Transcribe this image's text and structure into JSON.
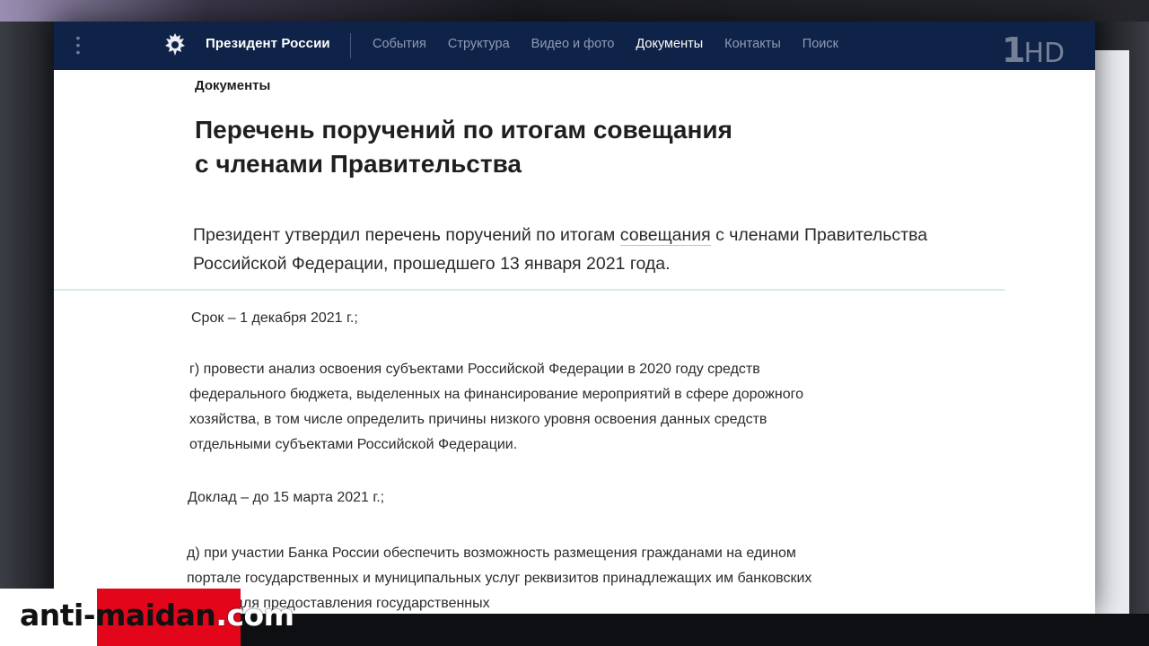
{
  "header": {
    "site_title": "Президент России",
    "nav": [
      "События",
      "Структура",
      "Видео и фото",
      "Документы",
      "Контакты",
      "Поиск"
    ],
    "active_nav_index": 3
  },
  "channel_logo": {
    "number": "1",
    "hd": "HD"
  },
  "content": {
    "breadcrumb": "Документы",
    "title_line1": "Перечень поручений по итогам совещания",
    "title_line2": "с членами Правительства",
    "lead_part1": "Президент утвердил перечень поручений по итогам ",
    "lead_link": "совещания",
    "lead_part2": " с членами Правительства Российской Федерации, прошедшего 13 января 2021 года.",
    "deadline1": "Срок – 1 декабря 2021 г.;",
    "item_g": "г) провести анализ освоения субъектами Российской Федерации в 2020 году средств федерального бюджета, выделенных на финансирование мероприятий в сфере дорожного хозяйства, в том числе определить причины низкого уровня освоения данных средств отдельными субъектами Российской Федерации.",
    "deadline2": "Доклад – до 15 марта 2021 г.;",
    "item_d": "д) при участии Банка России обеспечить возможность размещения гражданами на едином портале государственных и муниципальных услуг реквизитов принадлежащих им банковских счетов для предоставления государственных"
  },
  "watermark": {
    "part1": "anti-",
    "part2": "maidan",
    "part3": ".com"
  },
  "colors": {
    "header_bg": "#0f2247",
    "watermark_red": "#e3061b"
  }
}
